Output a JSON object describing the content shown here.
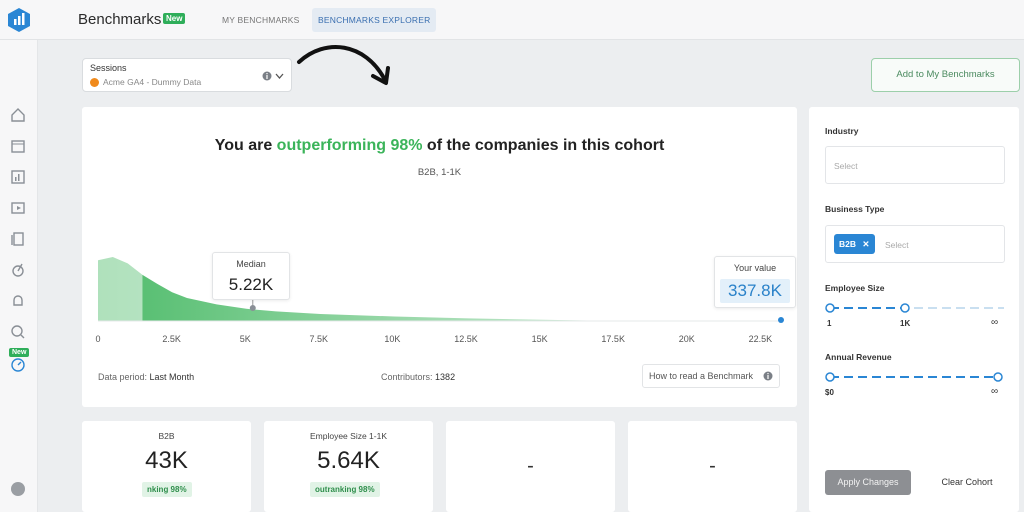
{
  "app": {
    "title": "Benchmarks",
    "new_badge": "New",
    "tabs": [
      {
        "label": "MY BENCHMARKS",
        "active": false
      },
      {
        "label": "BENCHMARKS EXPLORER",
        "active": true
      }
    ]
  },
  "sidebar": {
    "icons": [
      "home-icon",
      "calendar-icon",
      "chart-icon",
      "play-icon",
      "stack-icon",
      "graph-icon",
      "bell-icon",
      "search-icon",
      "benchmarks-icon"
    ],
    "new_badge": "New"
  },
  "metric_selector": {
    "label": "Sessions",
    "source": "Acme GA4 - Dummy Data"
  },
  "add_button": "Add to My Benchmarks",
  "headline": {
    "prefix": "You are ",
    "highlight": "outperforming 98%",
    "suffix": " of the companies in this cohort"
  },
  "cohort_label": "B2B, 1-1K",
  "chart_data": {
    "type": "area",
    "x_ticks": [
      "0",
      "2.5K",
      "5K",
      "7.5K",
      "10K",
      "12.5K",
      "15K",
      "17.5K",
      "20K",
      "22.5K"
    ],
    "x": [
      0,
      500,
      1000,
      1500,
      2000,
      2500,
      3000,
      4000,
      5000,
      6000,
      7500,
      10000,
      12500,
      15000,
      17500
    ],
    "y": [
      0.95,
      1.0,
      0.9,
      0.72,
      0.58,
      0.45,
      0.36,
      0.26,
      0.19,
      0.15,
      0.11,
      0.07,
      0.04,
      0.02,
      0.0
    ],
    "xlim": [
      0,
      23000
    ],
    "median": {
      "label": "Median",
      "value": "5.22K",
      "x": 5220
    },
    "your_value": {
      "label": "Your value",
      "value": "337.8K"
    }
  },
  "footer": {
    "period_label": "Data period:",
    "period_value": "Last Month",
    "contributors_label": "Contributors:",
    "contributors_value": "1382",
    "howto": "How to read a Benchmark"
  },
  "filters": {
    "industry": {
      "label": "Industry",
      "placeholder": "Select"
    },
    "business_type": {
      "label": "Business Type",
      "chip": "B2B",
      "placeholder": "Select"
    },
    "employee_size": {
      "label": "Employee Size",
      "min_label": "1",
      "mid_label": "1K",
      "max_label": "∞",
      "range_fraction": [
        0,
        0.4
      ]
    },
    "annual_revenue": {
      "label": "Annual Revenue",
      "min_label": "$0",
      "max_label": "∞",
      "range_fraction": [
        0,
        1
      ]
    },
    "apply": "Apply Changes",
    "clear": "Clear Cohort"
  },
  "stats": [
    {
      "label": "B2B",
      "value": "43K",
      "badge": "nking 98%"
    },
    {
      "label": "Employee Size 1-1K",
      "value": "5.64K",
      "badge": "outranking 98%"
    },
    {
      "label": "",
      "value": "-",
      "badge": ""
    },
    {
      "label": "",
      "value": "-",
      "badge": ""
    }
  ],
  "colors": {
    "accent_green": "#3bb45a",
    "accent_blue": "#2a86d4"
  }
}
